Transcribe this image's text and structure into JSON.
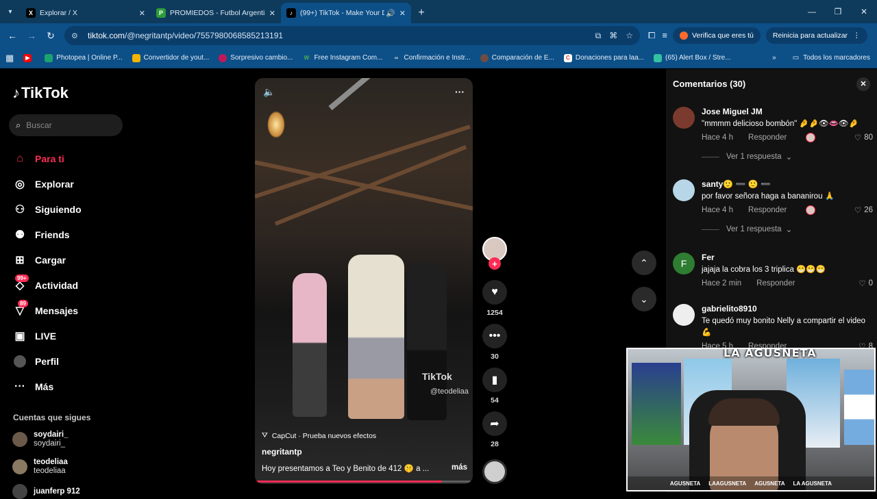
{
  "browser": {
    "tabs": [
      {
        "title": "Explorar / X",
        "active": false
      },
      {
        "title": "PROMIEDOS - Futbol Argentino",
        "active": false
      },
      {
        "title": "(99+) TikTok - Make Your Day",
        "active": true
      }
    ],
    "url_host": "tiktok.com",
    "url_path": "/@negritantp/video/7557980068585213191",
    "verify_chip": "Verifica que eres tú",
    "update_chip": "Reinicia para actualizar",
    "bookmarks": [
      "Photopea | Online P...",
      "Convertidor de yout...",
      "Sorpresivo cambio...",
      "Free Instagram Com...",
      "Confirmación e Instr...",
      "Comparación de E...",
      "Donaciones para laa...",
      "(65) Alert Box / Stre..."
    ],
    "all_bookmarks": "Todos los marcadores"
  },
  "sidebar": {
    "logo": "TikTok",
    "search_placeholder": "Buscar",
    "nav": [
      {
        "label": "Para ti",
        "icon": "home-icon"
      },
      {
        "label": "Explorar",
        "icon": "compass-icon"
      },
      {
        "label": "Siguiendo",
        "icon": "following-icon"
      },
      {
        "label": "Friends",
        "icon": "friends-icon"
      },
      {
        "label": "Cargar",
        "icon": "upload-icon"
      },
      {
        "label": "Actividad",
        "icon": "activity-icon",
        "badge": "99+"
      },
      {
        "label": "Mensajes",
        "icon": "messages-icon",
        "badge": "89"
      },
      {
        "label": "LIVE",
        "icon": "live-icon"
      },
      {
        "label": "Perfil",
        "icon": "profile-icon"
      },
      {
        "label": "Más",
        "icon": "more-icon"
      }
    ],
    "following_title": "Cuentas que sigues",
    "following": [
      {
        "name": "soydairi_",
        "sub": "soydairi_"
      },
      {
        "name": "teodeliaa",
        "sub": "teodeliaa"
      },
      {
        "name": "juanferp 912",
        "sub": ""
      }
    ]
  },
  "video": {
    "watermark": "TikTok",
    "watermark_user": "@teodeliaa",
    "effect": "CapCut · Prueba nuevos efectos",
    "author": "negritantp",
    "description": "Hoy presentamos a Teo y Benito de 412 🤫 a ...",
    "more": "más",
    "progress": 0.86
  },
  "actions": {
    "likes": "1254",
    "comments": "30",
    "saves": "54",
    "shares": "28"
  },
  "comments": {
    "title": "Comentarios (30)",
    "items": [
      {
        "user": "Jose Miguel JM",
        "text": "\"mmmm delicioso bombón\" 🤌🤌👁👄👁🤌",
        "time": "Hace 4 h",
        "reply": "Responder",
        "likes": "80",
        "replies": "Ver 1 respuesta"
      },
      {
        "user": "santy🙂 ➖ 🙂 ➖",
        "text": "por favor señora haga a bananirou 🙏",
        "time": "Hace 4 h",
        "reply": "Responder",
        "likes": "26",
        "replies": "Ver 1 respuesta"
      },
      {
        "user": "Fer",
        "avatar_letter": "F",
        "text": "jajaja la cobra los 3 triplica 😁😁😁",
        "time": "Hace 2 min",
        "reply": "Responder",
        "likes": "0"
      },
      {
        "user": "gabrielito8910",
        "text": "Te quedó muy bonito Nelly a compartir el video 💪",
        "time": "Hace 5 h",
        "reply": "Responder",
        "likes": "8"
      }
    ]
  },
  "webcam": {
    "logo": "LA AGUSNETA",
    "socials": [
      "AGUSNETA",
      "LAAGUSNETA",
      "AGUSNETA",
      "LA AGUSNETA"
    ]
  },
  "colors": {
    "accent": "#fe2c55",
    "chrome": "#0d4f87"
  }
}
